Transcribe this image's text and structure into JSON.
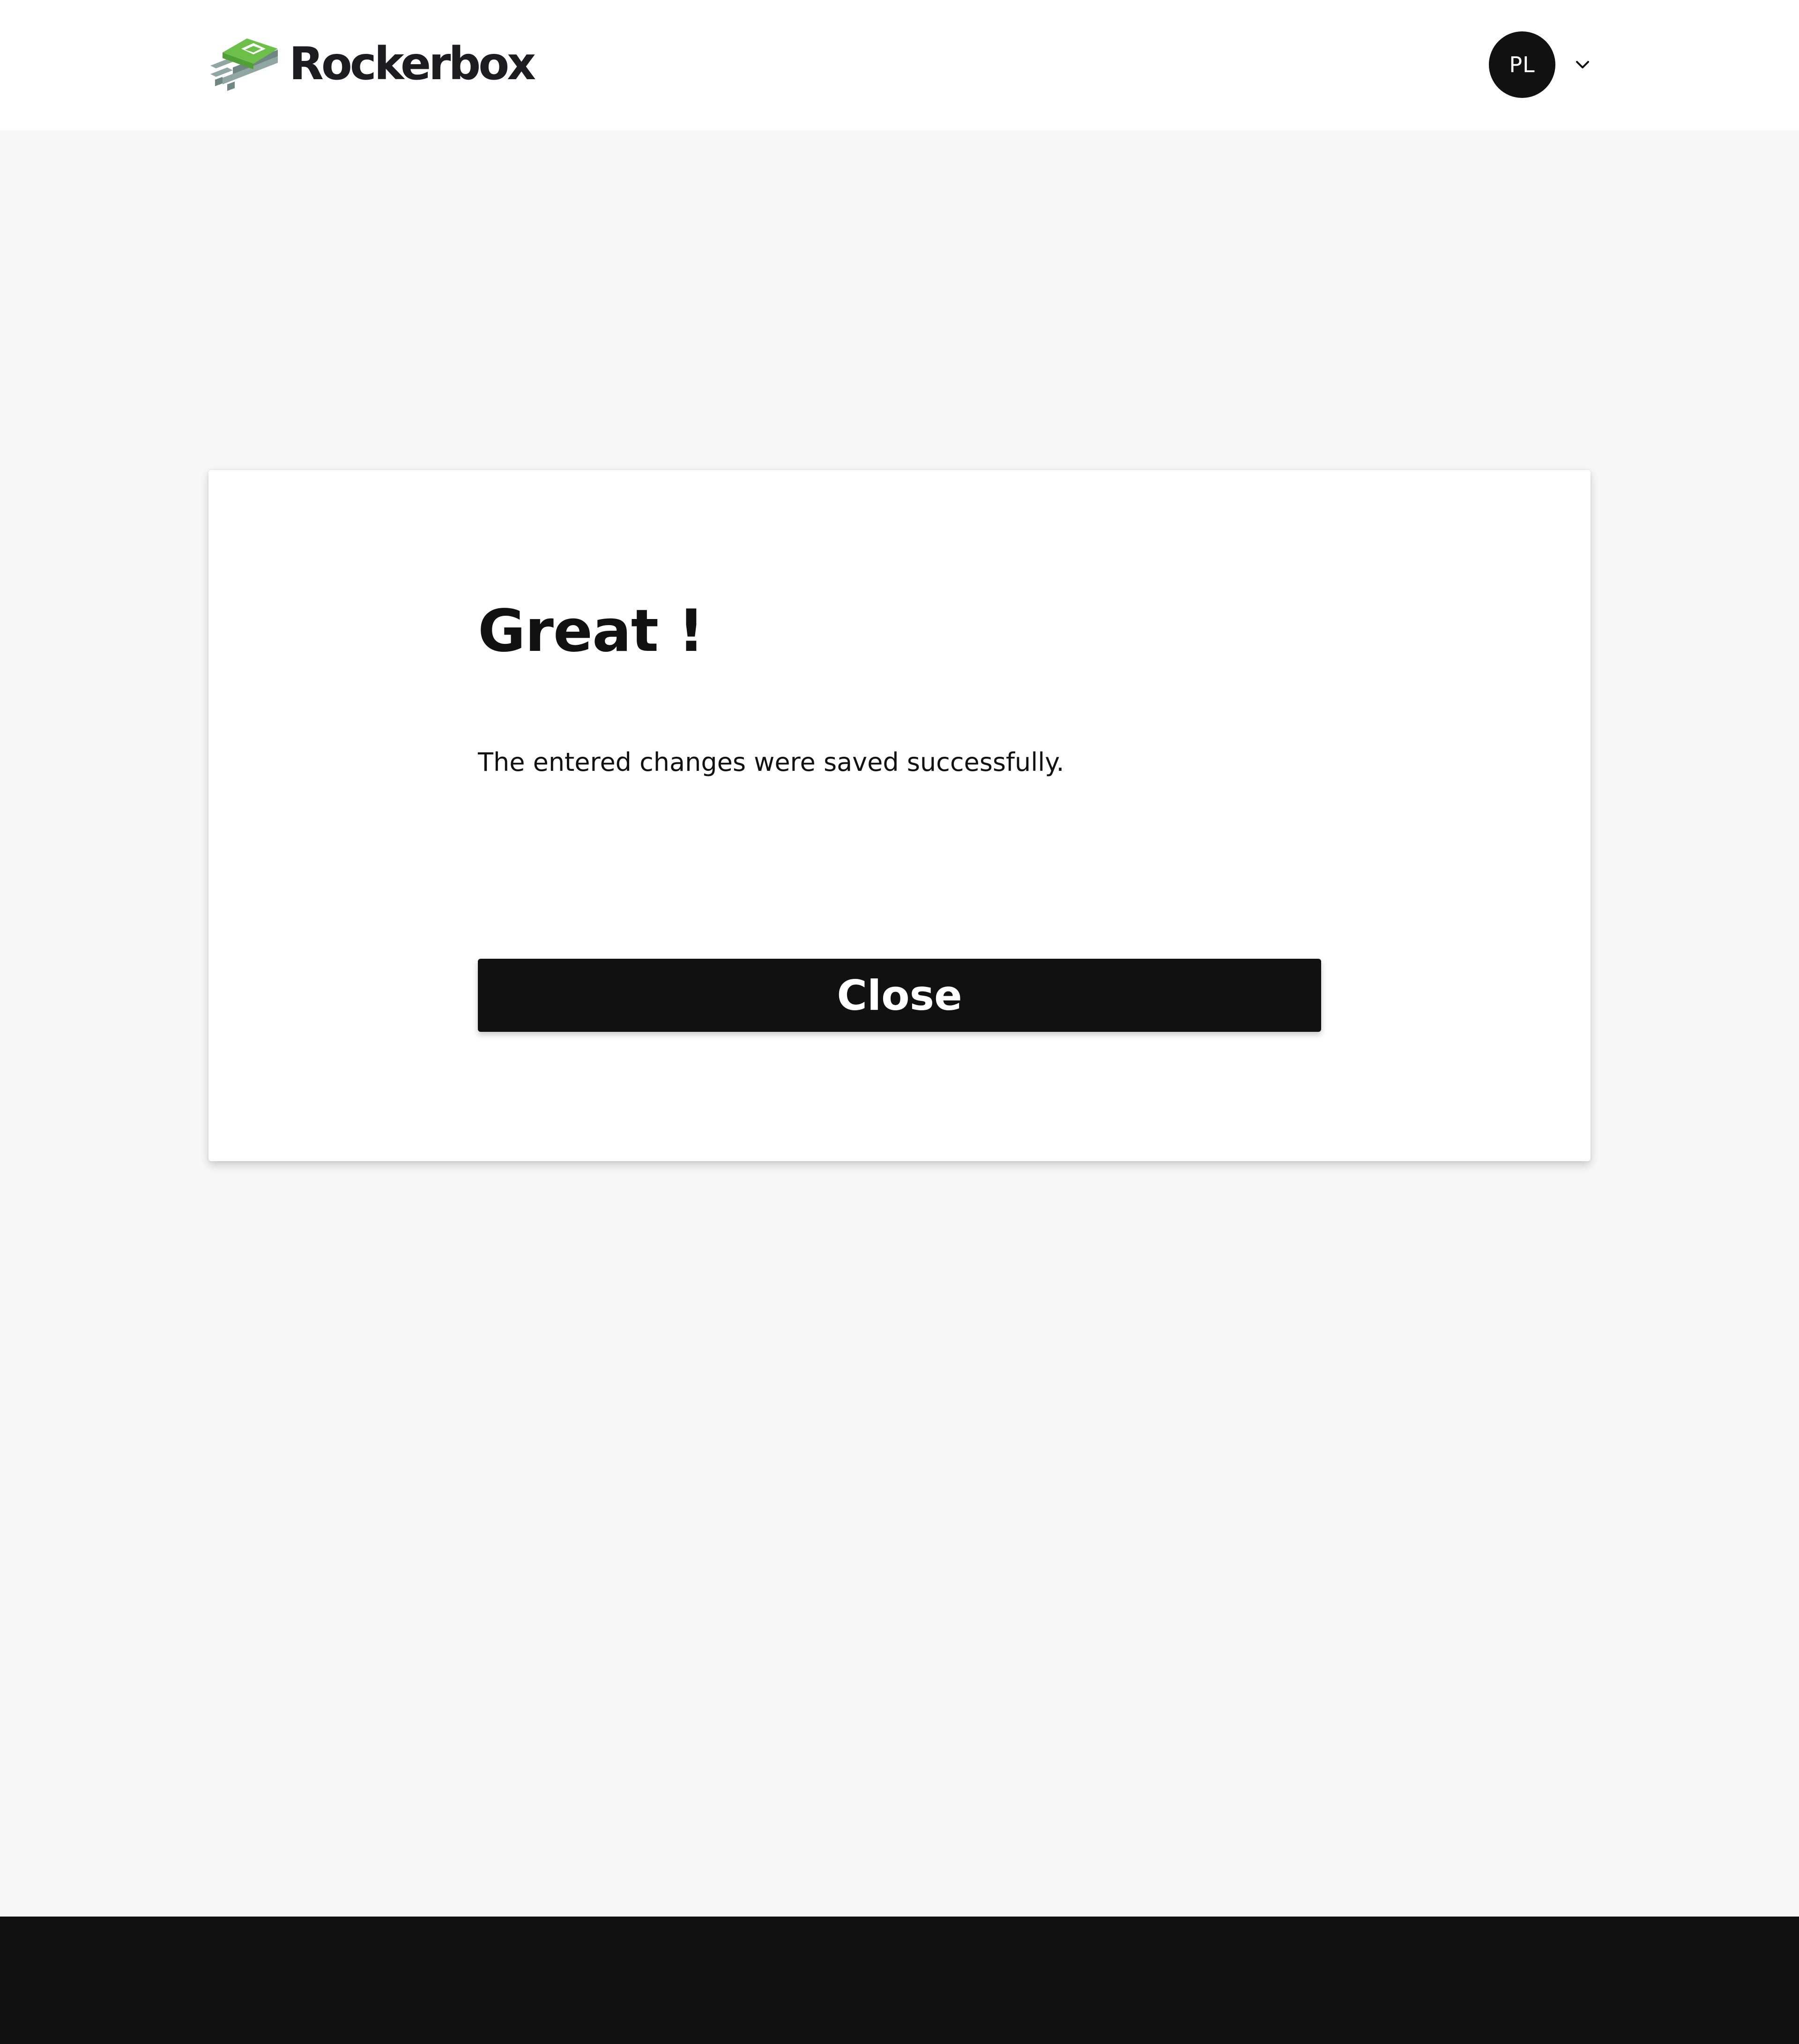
{
  "header": {
    "brand_name": "Rockerbox",
    "logo_icon": "rockerbox-layers-logo",
    "user": {
      "initials": "PL",
      "menu_icon": "chevron-down-icon"
    }
  },
  "dialog": {
    "title": "Great !",
    "message": "The entered changes were saved successfully.",
    "close_label": "Close"
  },
  "colors": {
    "background": "#f7f7f7",
    "card": "#ffffff",
    "primary_dark": "#111111",
    "brand_green": "#6cc04a",
    "brand_gray": "#8fa6a1"
  }
}
